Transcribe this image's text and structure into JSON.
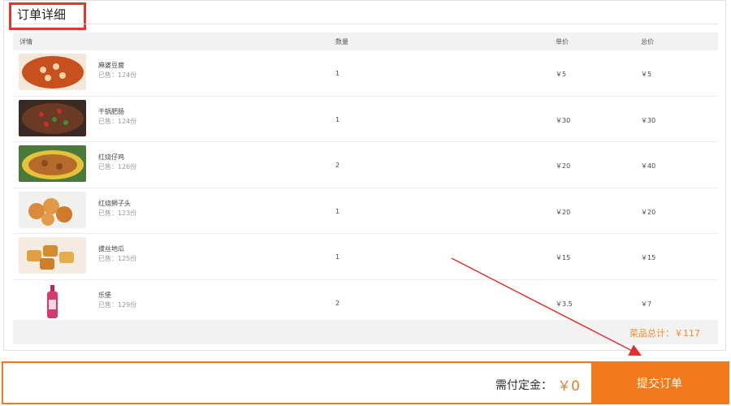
{
  "page": {
    "title": "订单详细"
  },
  "table": {
    "headers": {
      "details": "详情",
      "qty": "数量",
      "unit_price": "单价",
      "total": "总价"
    },
    "rows": [
      {
        "name": "麻婆豆腐",
        "sold": "已售：124份",
        "qty": "1",
        "unit_price": "￥5",
        "total": "￥5",
        "thumb_color": "#c8501f"
      },
      {
        "name": "干锅肥肠",
        "sold": "已售：124份",
        "qty": "1",
        "unit_price": "￥30",
        "total": "￥30",
        "thumb_color": "#6a3a24"
      },
      {
        "name": "红烧仔鸡",
        "sold": "已售：126份",
        "qty": "2",
        "unit_price": "￥20",
        "total": "￥40",
        "thumb_color": "#b56b2a"
      },
      {
        "name": "红烧狮子头",
        "sold": "已售：123份",
        "qty": "1",
        "unit_price": "￥20",
        "total": "￥20",
        "thumb_color": "#d98a3a"
      },
      {
        "name": "拔丝地瓜",
        "sold": "已售：125份",
        "qty": "1",
        "unit_price": "￥15",
        "total": "￥15",
        "thumb_color": "#e0a040"
      },
      {
        "name": "乐堡",
        "sold": "已售：129份",
        "qty": "2",
        "unit_price": "￥3.5",
        "total": "￥7",
        "thumb_color": "#d43a6e"
      }
    ]
  },
  "summary": {
    "text": "菜品总计：￥117"
  },
  "footer": {
    "deposit_label": "需付定金：",
    "deposit_value": "￥0",
    "submit_label": "提交订单"
  },
  "colors": {
    "accent": "#f27a1a",
    "highlight_box": "#e8352c",
    "arrow": "#e0302a"
  }
}
